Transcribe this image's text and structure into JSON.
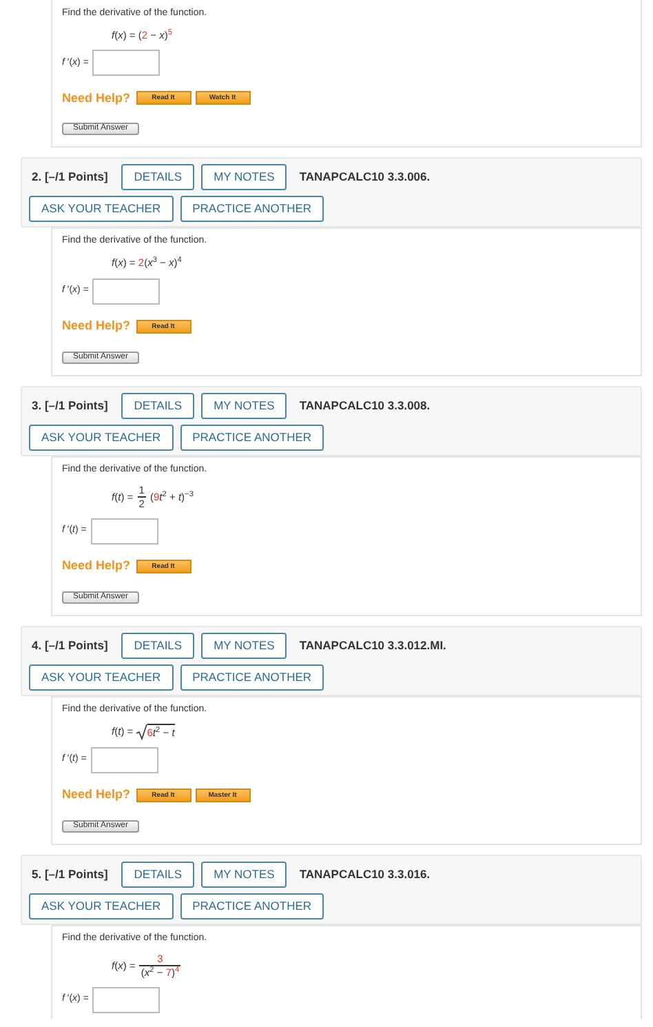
{
  "questions": [
    {
      "prompt": "Find the derivative of the function.",
      "formula": [
        {
          "kind": "text",
          "text": "*f*(*x*) = ("
        },
        {
          "kind": "highlight",
          "text": "2"
        },
        {
          "kind": "text",
          "text": " − *x*)"
        },
        {
          "kind": "highlight",
          "text": "$^{5}$"
        }
      ],
      "answer_label": "*f* ′(*x*) =",
      "need_help": "Need Help?",
      "help_buttons": [
        "Read It",
        "Watch It"
      ],
      "submit": "Submit Answer"
    },
    {
      "number": "2.",
      "points": "[–/1 Points]",
      "buttons": [
        "DETAILS",
        "MY NOTES"
      ],
      "code": "TANAPCALC10 3.3.006.",
      "actions": [
        "ASK YOUR TEACHER",
        "PRACTICE ANOTHER"
      ],
      "prompt": "Find the derivative of the function.",
      "formula": [
        {
          "kind": "text",
          "text": "*f*(*x*) = "
        },
        {
          "kind": "highlight",
          "text": "2"
        },
        {
          "kind": "text",
          "text": "(*x*$^{3}$ − *x*)$^{4}$"
        }
      ],
      "answer_label": "*f* ′(*x*) =",
      "need_help": "Need Help?",
      "help_buttons": [
        "Read It"
      ],
      "submit": "Submit Answer"
    },
    {
      "number": "3.",
      "points": "[–/1 Points]",
      "buttons": [
        "DETAILS",
        "MY NOTES"
      ],
      "code": "TANAPCALC10 3.3.008.",
      "actions": [
        "ASK YOUR TEACHER",
        "PRACTICE ANOTHER"
      ],
      "prompt": "Find the derivative of the function.",
      "formula": [
        {
          "kind": "text",
          "text": "*f*(*t*) = "
        },
        {
          "kind": "frac",
          "numerator": [
            {
              "kind": "text",
              "text": "1"
            }
          ],
          "denominator": [
            {
              "kind": "text",
              "text": "2"
            }
          ]
        },
        {
          "kind": "text",
          "text": " ("
        },
        {
          "kind": "highlight",
          "text": "9"
        },
        {
          "kind": "text",
          "text": "*t*$^{2}$ + *t*)$^{−3}$"
        }
      ],
      "answer_label": "*f* ′(*t*) =",
      "need_help": "Need Help?",
      "help_buttons": [
        "Read It"
      ],
      "submit": "Submit Answer"
    },
    {
      "number": "4.",
      "points": "[–/1 Points]",
      "buttons": [
        "DETAILS",
        "MY NOTES"
      ],
      "code": "TANAPCALC10 3.3.012.MI.",
      "actions": [
        "ASK YOUR TEACHER",
        "PRACTICE ANOTHER"
      ],
      "prompt": "Find the derivative of the function.",
      "formula": [
        {
          "kind": "text",
          "text": "*f*(*t*) = "
        },
        {
          "kind": "sqrt",
          "children": [
            {
              "kind": "highlight",
              "text": "6"
            },
            {
              "kind": "text",
              "text": "*t*$^{2}$ − *t*"
            }
          ]
        }
      ],
      "answer_label": "*f* ′(*t*) =",
      "need_help": "Need Help?",
      "help_buttons": [
        "Read It",
        "Master It"
      ],
      "submit": "Submit Answer"
    },
    {
      "number": "5.",
      "points": "[–/1 Points]",
      "buttons": [
        "DETAILS",
        "MY NOTES"
      ],
      "code": "TANAPCALC10 3.3.016.",
      "actions": [
        "ASK YOUR TEACHER",
        "PRACTICE ANOTHER"
      ],
      "prompt": "Find the derivative of the function.",
      "formula": [
        {
          "kind": "text",
          "text": "*f*(*x*) = "
        },
        {
          "kind": "frac",
          "numerator": [
            {
              "kind": "highlight",
              "text": "3"
            }
          ],
          "denominator": [
            {
              "kind": "text",
              "text": "(*x*$^{2}$ − "
            },
            {
              "kind": "highlight",
              "text": "7"
            },
            {
              "kind": "text",
              "text": ")"
            },
            {
              "kind": "highlight",
              "text": "$^{4}$"
            }
          ]
        }
      ],
      "answer_label": "*f* ′(*x*) ="
    }
  ]
}
